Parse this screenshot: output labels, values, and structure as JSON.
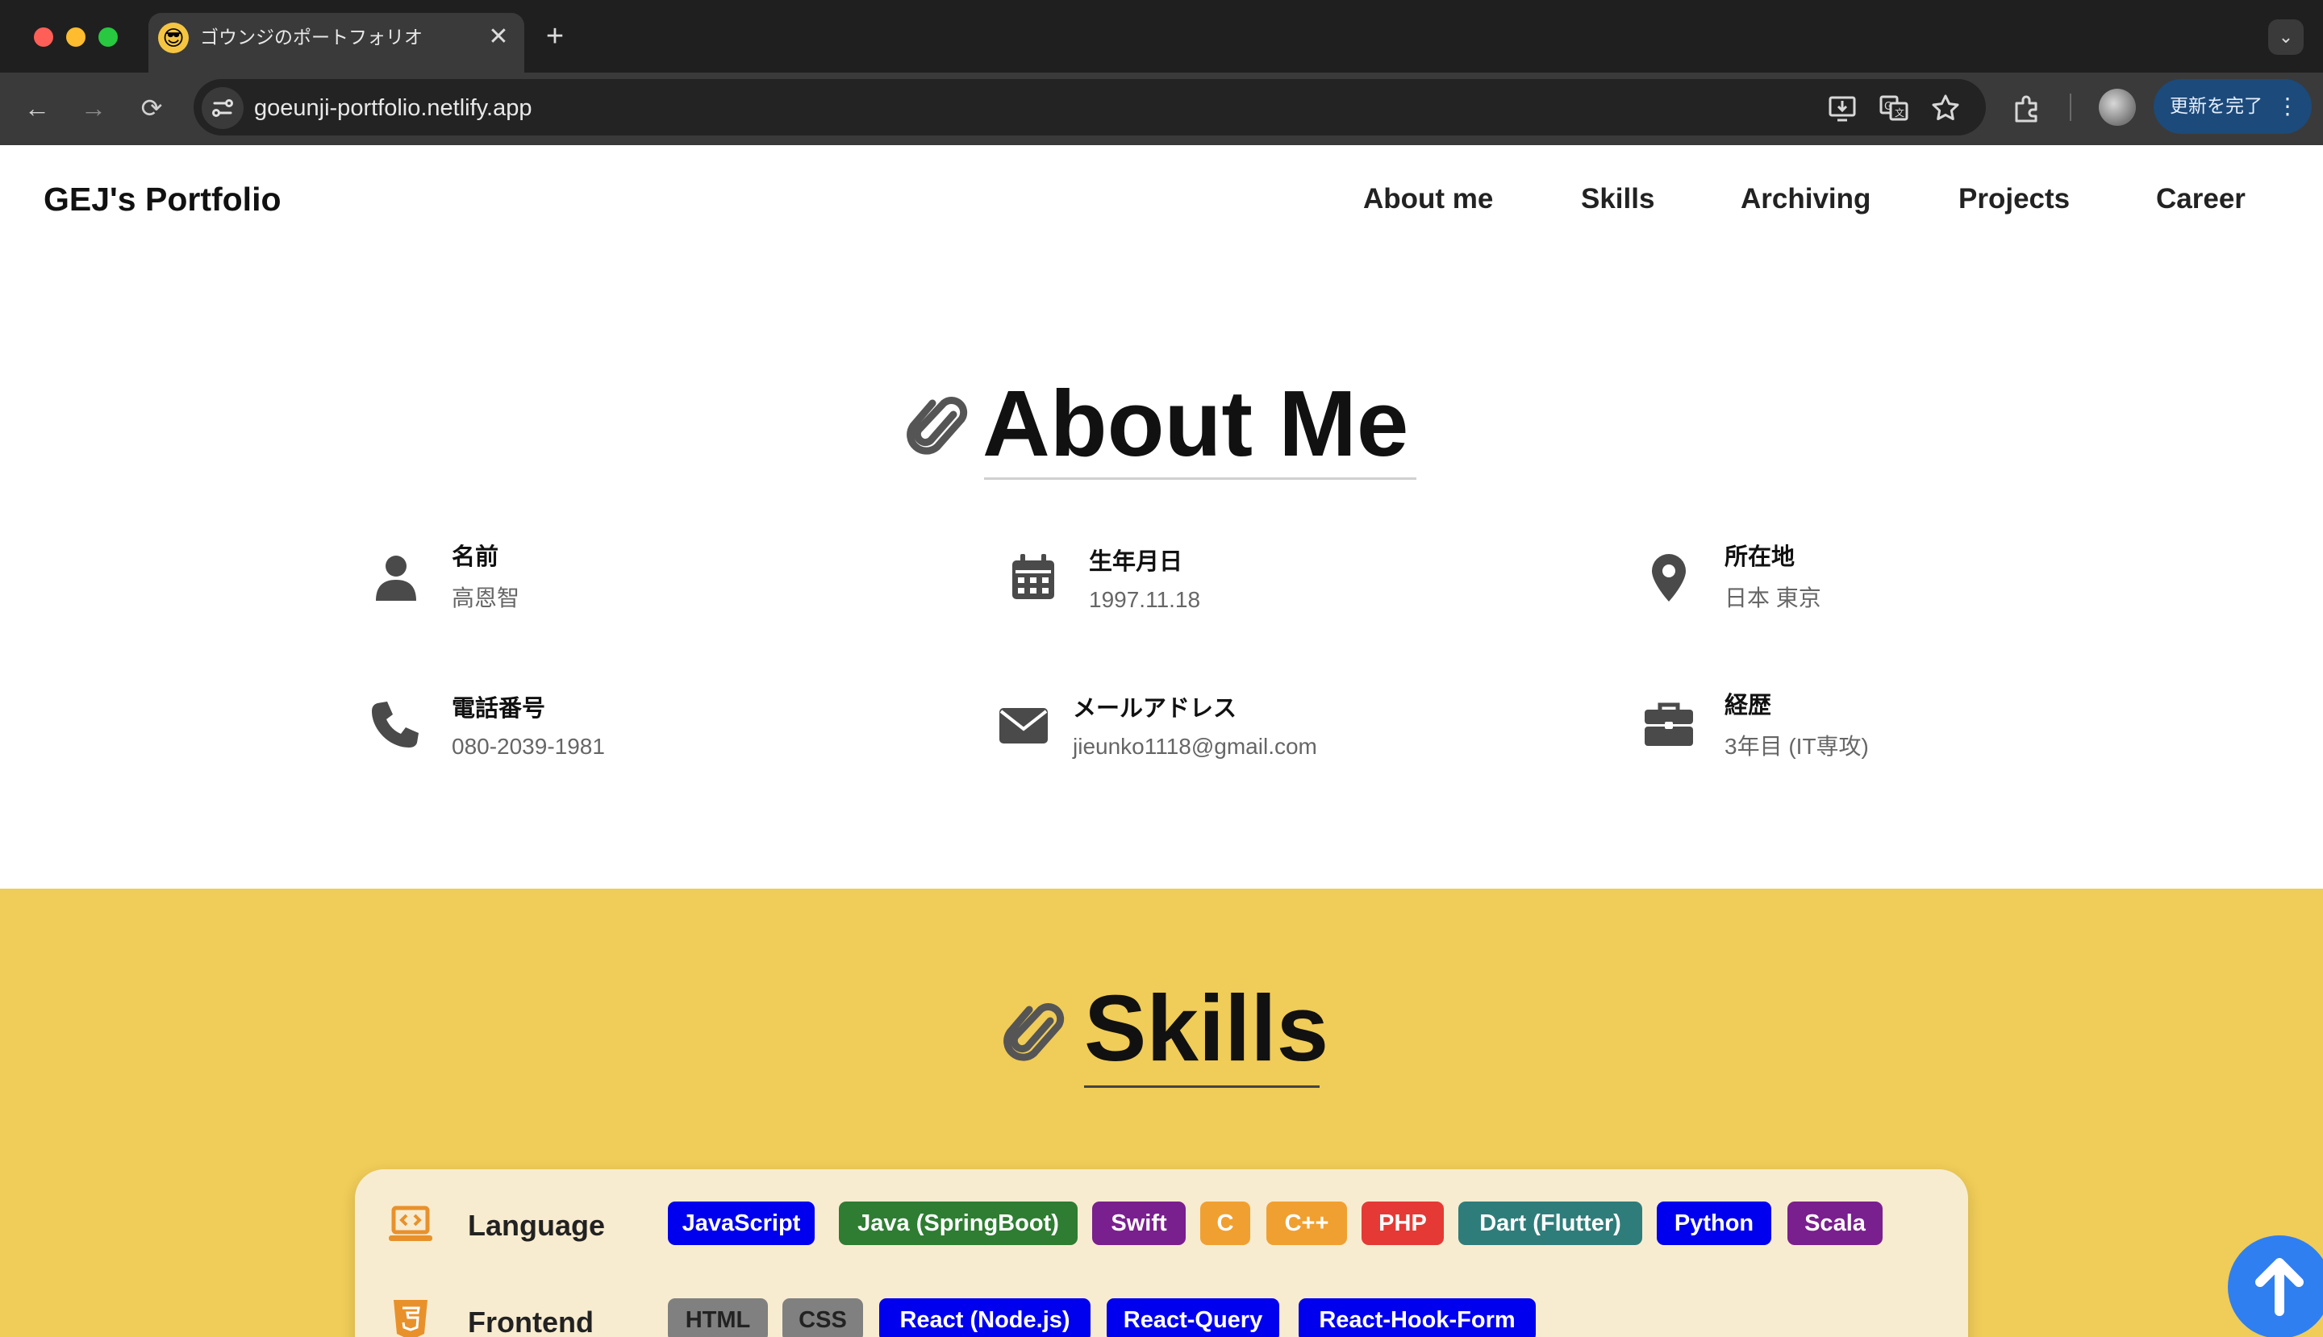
{
  "browser": {
    "tab_title": "ゴウンジのポートフォリオ",
    "tab_favicon": "😎",
    "tab_close": "✕",
    "new_tab": "+",
    "tab_menu": "⌄",
    "url": "goeunji-portfolio.netlify.app",
    "update_button_label": "更新を完了",
    "update_menu": "⋮",
    "nav": {
      "back": "←",
      "forward": "→",
      "reload": "⟳"
    },
    "icons": [
      "site-info-icon",
      "install-app-icon",
      "translate-icon",
      "bookmark-star-icon",
      "extensions-icon",
      "profile-avatar"
    ]
  },
  "site": {
    "brand": "GEJ's Portfolio",
    "nav": [
      "About me",
      "Skills",
      "Archiving",
      "Projects",
      "Career"
    ]
  },
  "about": {
    "title": "About Me",
    "items": [
      {
        "icon": "person-icon",
        "label": "名前",
        "value": "高恩智"
      },
      {
        "icon": "calendar-icon",
        "label": "生年月日",
        "value": "1997.11.18"
      },
      {
        "icon": "location-pin-icon",
        "label": "所在地",
        "value": "日本 東京"
      },
      {
        "icon": "phone-icon",
        "label": "電話番号",
        "value": "080-2039-1981"
      },
      {
        "icon": "mail-icon",
        "label": "メールアドレス",
        "value": "jieunko1118@gmail.com"
      },
      {
        "icon": "briefcase-icon",
        "label": "経歴",
        "value": "3年目 (IT専攻)"
      }
    ]
  },
  "skills": {
    "title": "Skills",
    "background": "#f0cc58",
    "categories": [
      {
        "icon": "laptop-code-icon",
        "label": "Language",
        "badges": [
          {
            "text": "JavaScript",
            "color": "#0000ee"
          },
          {
            "text": "Java (SpringBoot)",
            "color": "#2e7d32"
          },
          {
            "text": "Swift",
            "color": "#7a1f8e"
          },
          {
            "text": "C",
            "color": "#f0a030"
          },
          {
            "text": "C++",
            "color": "#f0a030"
          },
          {
            "text": "PHP",
            "color": "#e53935"
          },
          {
            "text": "Dart (Flutter)",
            "color": "#2f7d7a"
          },
          {
            "text": "Python",
            "color": "#0000ee"
          },
          {
            "text": "Scala",
            "color": "#7a1f8e"
          }
        ]
      },
      {
        "icon": "html5-icon",
        "label": "Frontend",
        "badges": [
          {
            "text": "HTML",
            "color": "#808080"
          },
          {
            "text": "CSS",
            "color": "#808080"
          },
          {
            "text": "React (Node.js)",
            "color": "#0000ee"
          },
          {
            "text": "React-Query",
            "color": "#0000ee"
          },
          {
            "text": "React-Hook-Form",
            "color": "#0000ee"
          }
        ]
      }
    ]
  },
  "scroll_top": {
    "icon": "arrow-up-icon",
    "color": "#2f7ff0"
  }
}
